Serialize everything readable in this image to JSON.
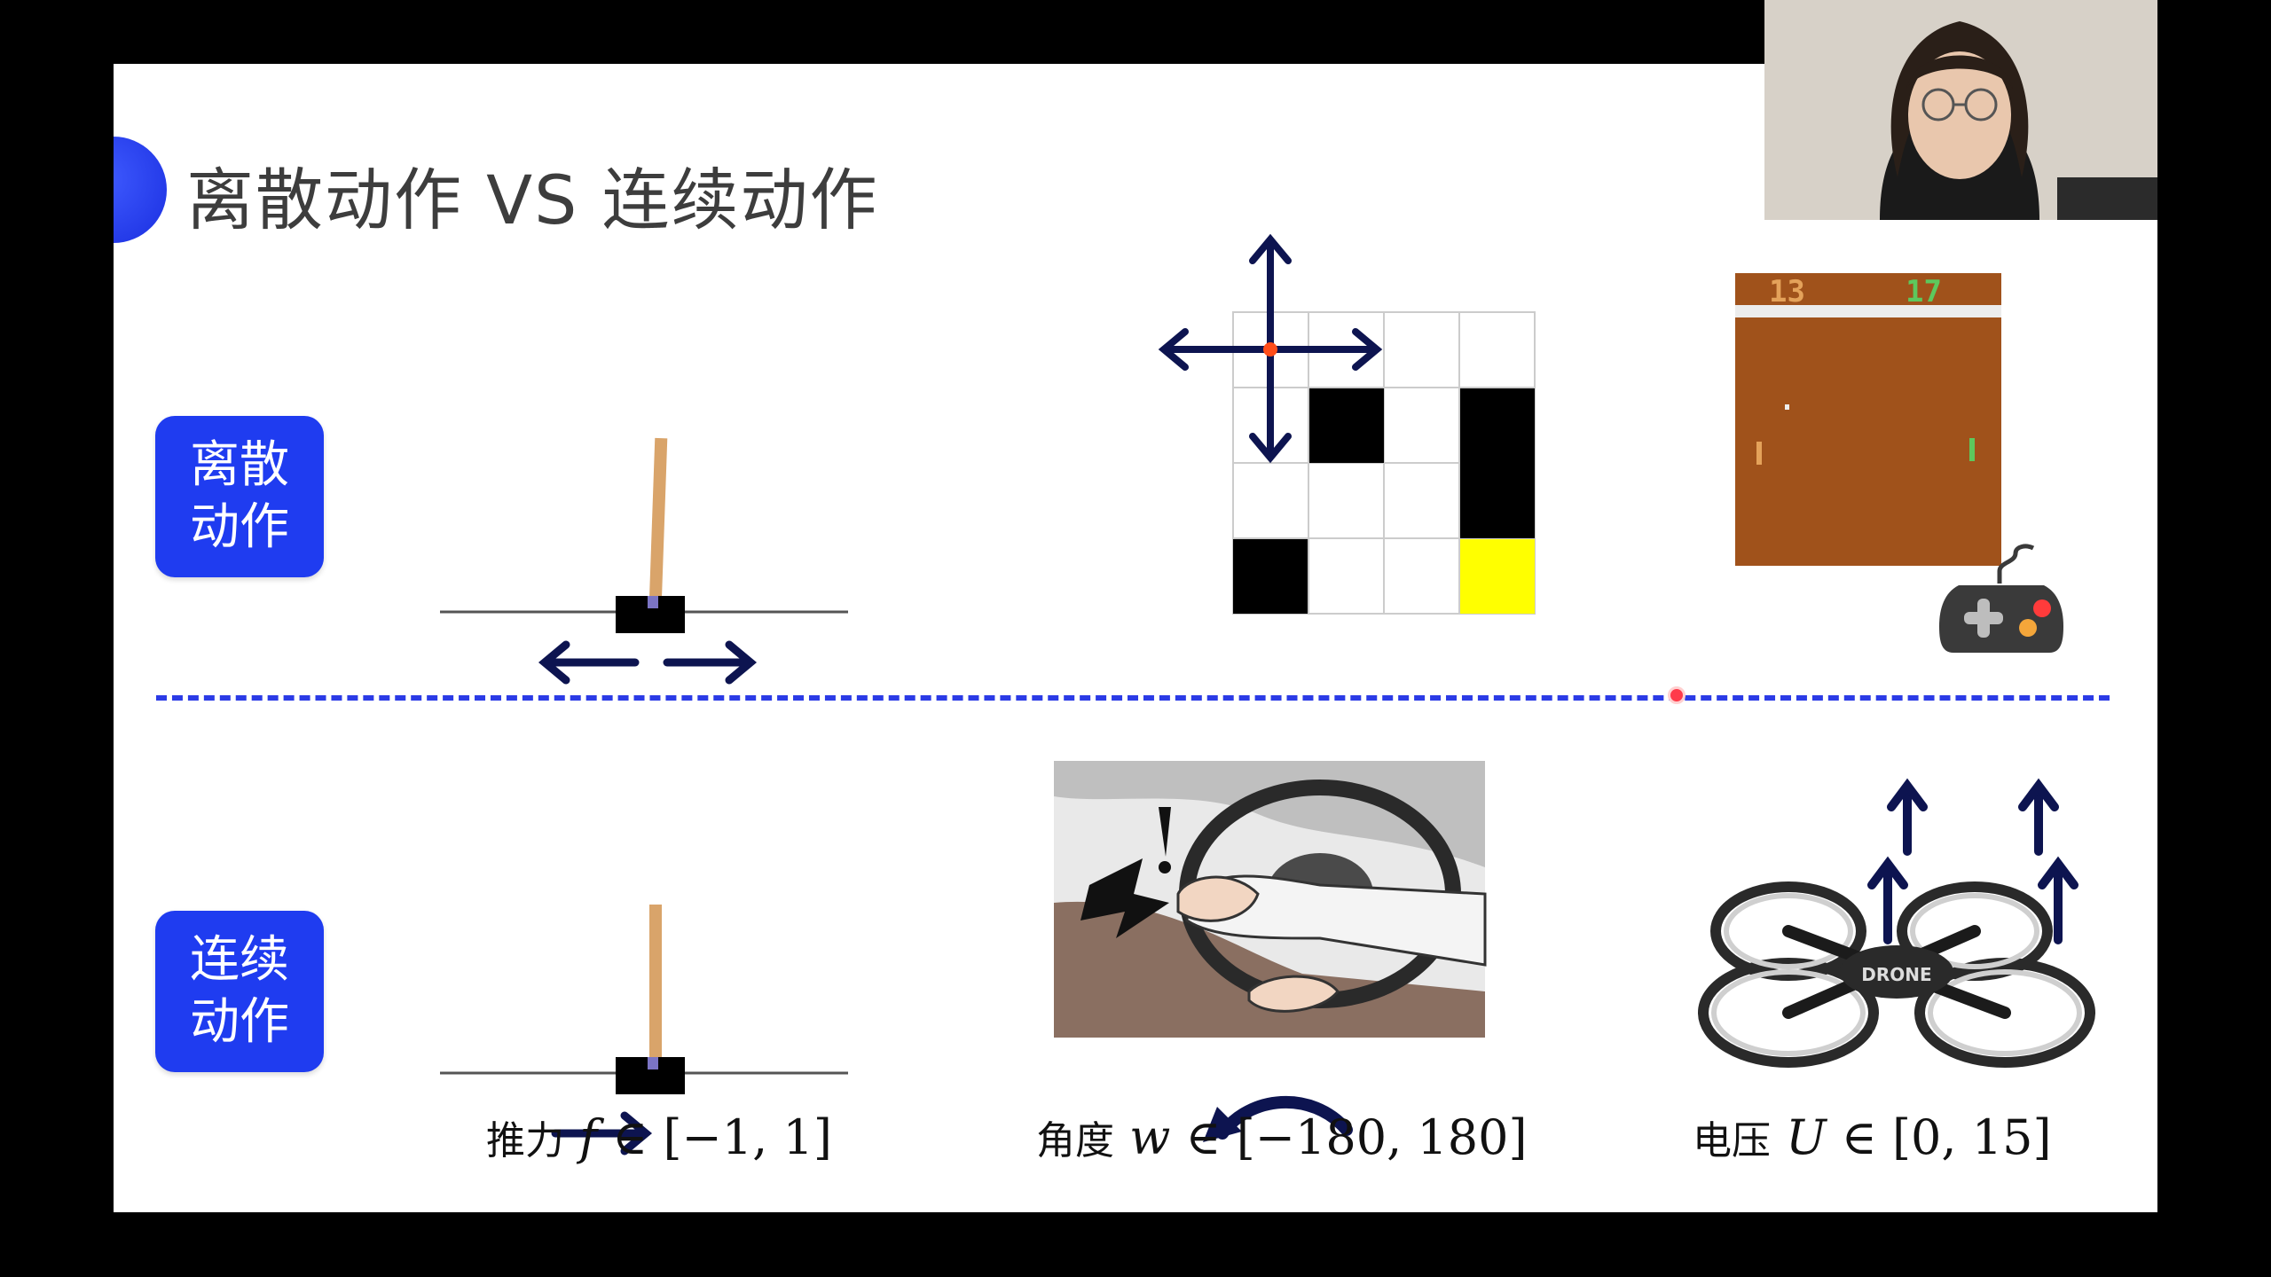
{
  "slide": {
    "title": "离散动作 VS 连续动作",
    "labels": {
      "discrete_line1": "离散",
      "discrete_line2": "动作",
      "continuous_line1": "连续",
      "continuous_line2": "动作"
    },
    "pong_scores": {
      "left": "13",
      "right": "17"
    },
    "formulas": {
      "thrust": {
        "cn": "推力",
        "var": "f",
        "rest": " ∈ [−1, 1]"
      },
      "angle": {
        "cn": "角度",
        "var": "w",
        "rest": " ∈ [−180, 180]"
      },
      "voltage": {
        "cn": "电压",
        "var": "U",
        "rest": " ∈ [0, 15]"
      }
    },
    "drone_brand": "DRONE",
    "colors": {
      "accent_blue": "#1f3cf0",
      "arrow_navy": "#0d1450",
      "divider_blue": "#2b3be6",
      "pong_field": "#a0521b",
      "goal_yellow": "#ffff00"
    },
    "icons": [
      "cartpole-icon",
      "gridworld-icon",
      "pong-game-icon",
      "gamepad-icon",
      "steering-wheel-image",
      "quadcopter-icon"
    ]
  }
}
